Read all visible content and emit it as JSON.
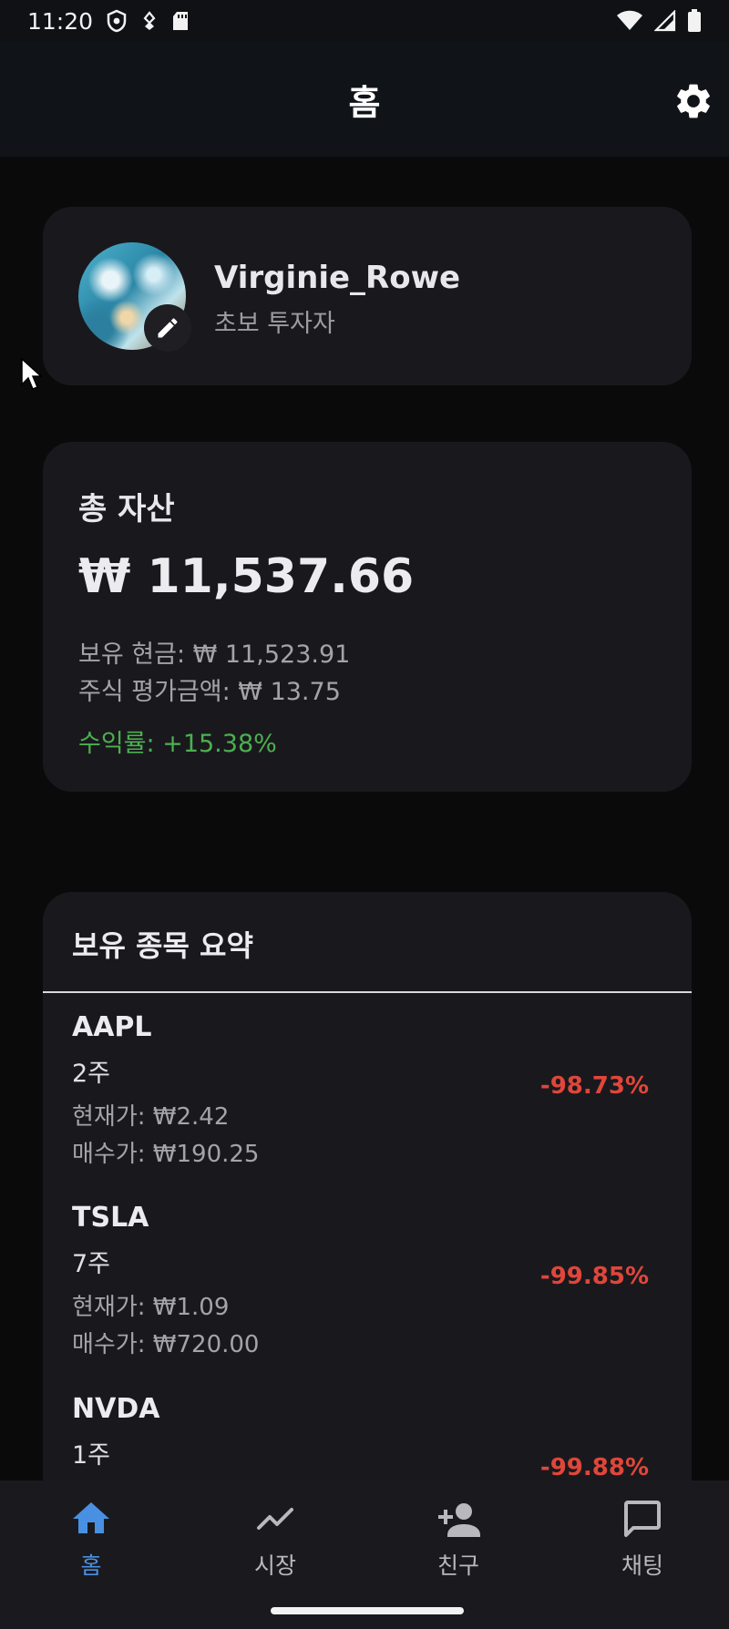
{
  "status_bar": {
    "time": "11:20",
    "icons_left": [
      "shield-icon",
      "signal-dot-icon",
      "sd-card-icon"
    ],
    "icons_right": [
      "wifi-icon",
      "cell-signal-icon",
      "battery-icon"
    ]
  },
  "app_bar": {
    "title": "홈",
    "settings_icon": "gear-icon"
  },
  "profile": {
    "username": "Virginie_Rowe",
    "level": "초보 투자자",
    "edit_icon": "pencil-icon"
  },
  "assets": {
    "title": "총 자산",
    "total": "₩ 11,537.66",
    "cash": "보유 현금: ₩ 11,523.91",
    "stock_value": "주식 평가금액: ₩ 13.75",
    "return_rate": "수익률: +15.38%",
    "return_color": "#4caf50"
  },
  "holdings": {
    "title": "보유 종목 요약",
    "items": [
      {
        "symbol": "AAPL",
        "qty": "2주",
        "current": "현재가: ₩2.42",
        "buy": "매수가: ₩190.25",
        "change": "-98.73%"
      },
      {
        "symbol": "TSLA",
        "qty": "7주",
        "current": "현재가: ₩1.09",
        "buy": "매수가: ₩720.00",
        "change": "-99.85%"
      },
      {
        "symbol": "NVDA",
        "qty": "1주",
        "current": "",
        "buy": "",
        "change": "-99.88%"
      }
    ],
    "negative_color": "#e0463a"
  },
  "bottom_nav": {
    "items": [
      {
        "label": "홈",
        "icon": "home-icon",
        "active": true
      },
      {
        "label": "시장",
        "icon": "trending-line-icon",
        "active": false
      },
      {
        "label": "친구",
        "icon": "person-add-icon",
        "active": false
      },
      {
        "label": "채팅",
        "icon": "chat-bubble-icon",
        "active": false
      }
    ],
    "accent": "#4a90e2"
  }
}
